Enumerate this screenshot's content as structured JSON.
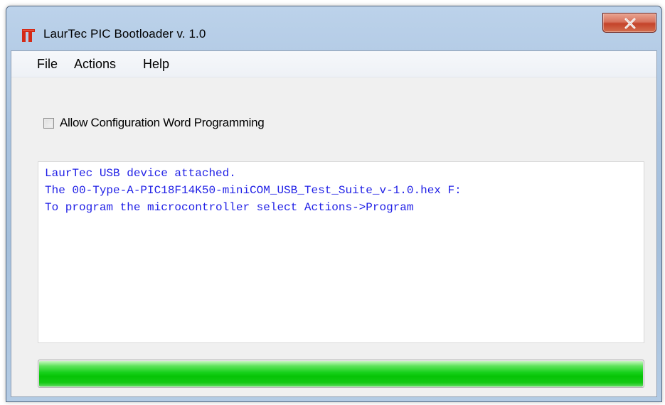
{
  "window": {
    "title": "LaurTec PIC Bootloader v. 1.0",
    "icon": "laurtec-logo-icon",
    "close_icon": "close-x-icon"
  },
  "menu": {
    "items": [
      {
        "label": "File"
      },
      {
        "label": "Actions"
      },
      {
        "label": "Help"
      }
    ]
  },
  "options": {
    "config_word_label": "Allow Configuration Word Programming",
    "config_word_checked": false
  },
  "log": {
    "color": "#1f1fe6",
    "lines": [
      "LaurTec USB device attached.",
      "The 00-Type-A-PIC18F14K50-miniCOM_USB_Test_Suite_v-1.0.hex F:",
      "To program the microcontroller select Actions->Program"
    ]
  },
  "progress": {
    "value": 1.0,
    "color": "#06c406"
  },
  "colors": {
    "close_button": "#c4432a",
    "icon": "#d42a17"
  }
}
